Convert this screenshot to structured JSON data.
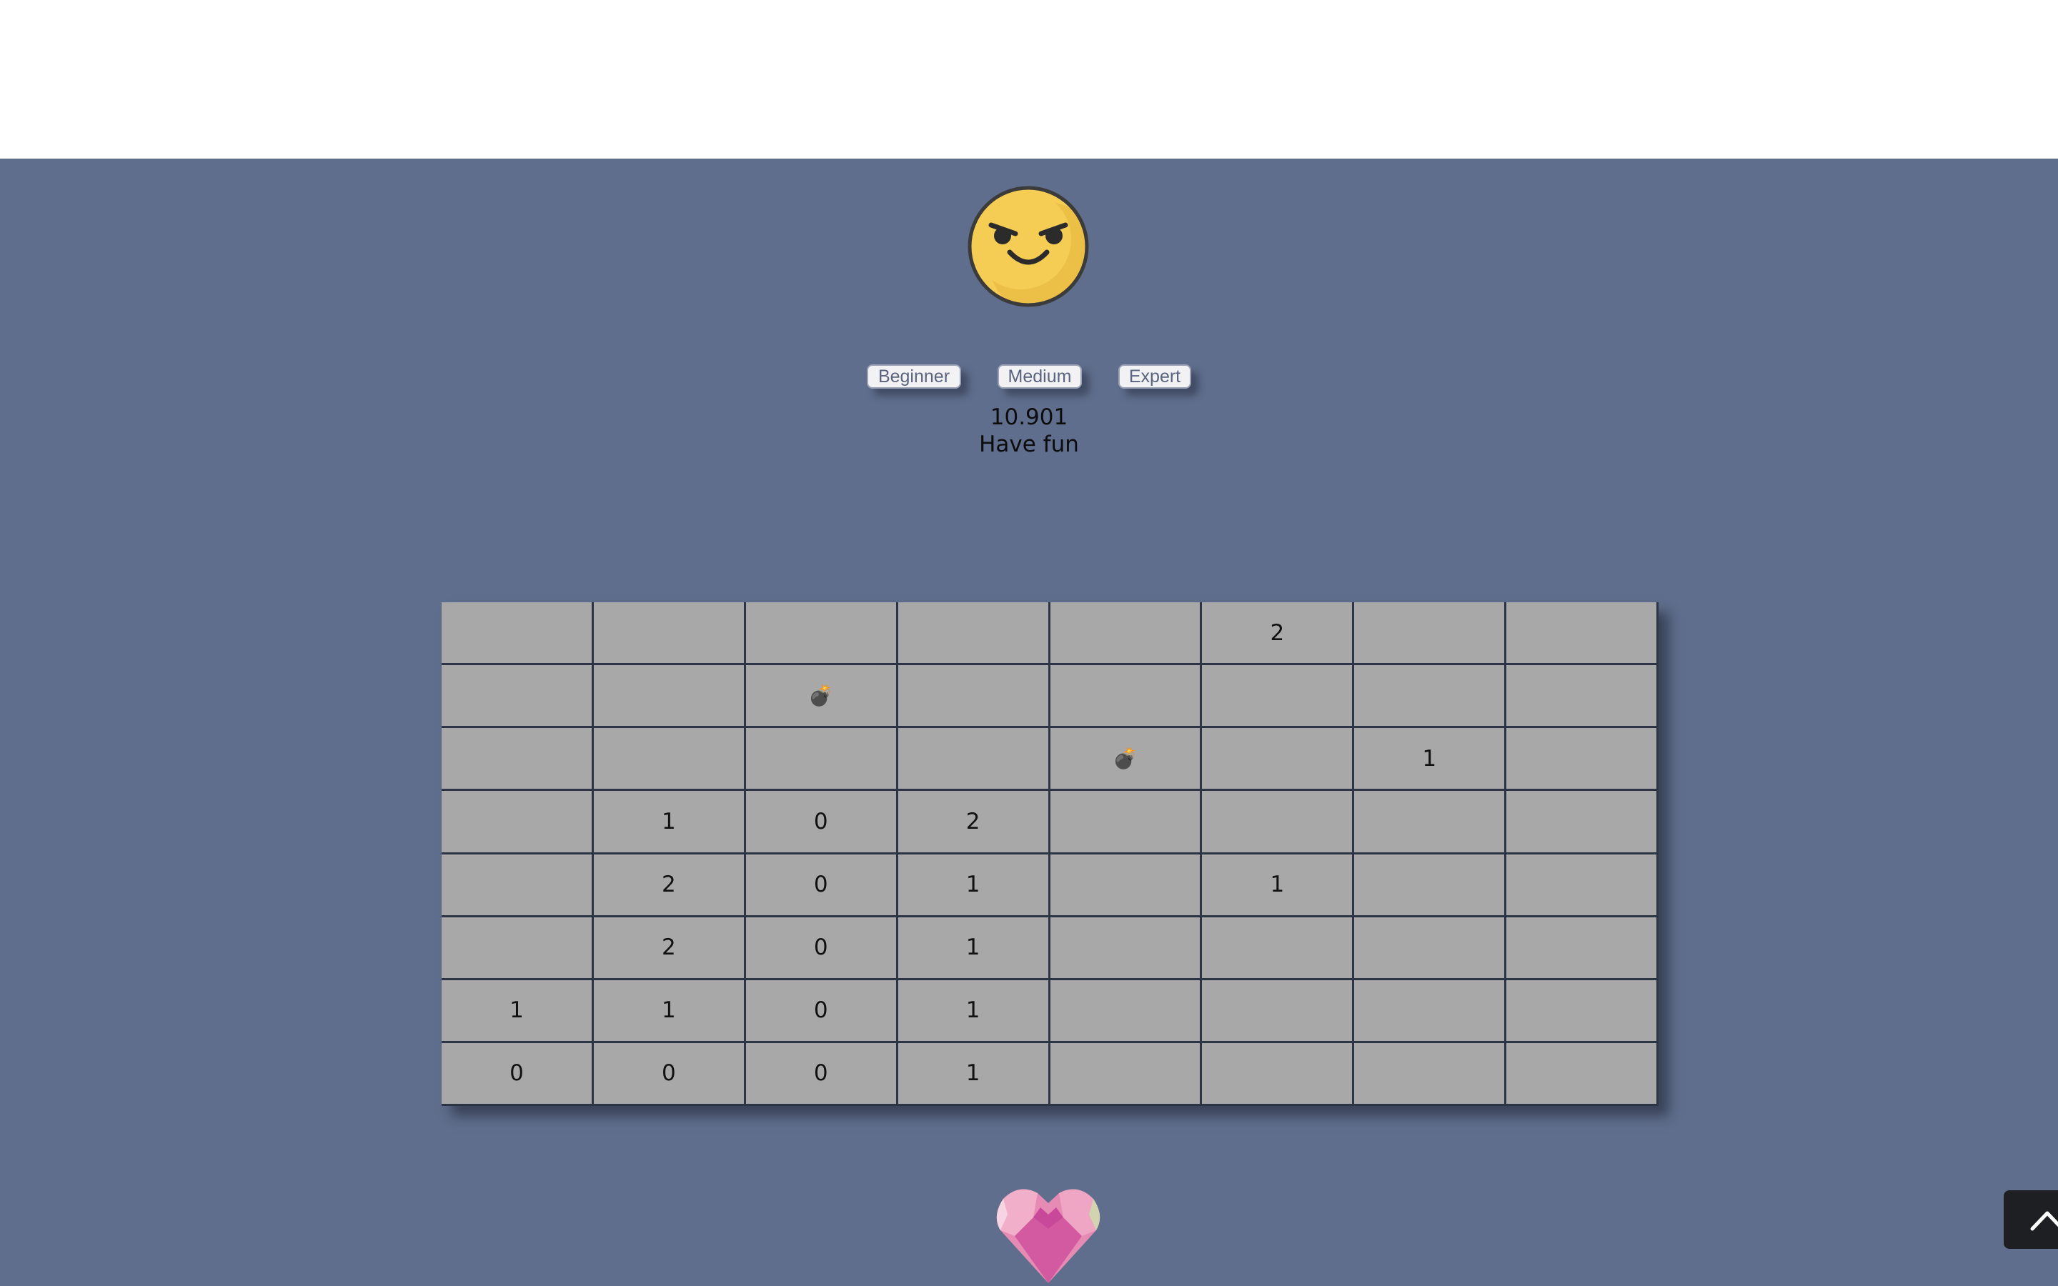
{
  "face": {
    "icon": "angry-smiley-icon",
    "color": "#f5cd55"
  },
  "levels": [
    {
      "label": "Beginner"
    },
    {
      "label": "Medium"
    },
    {
      "label": "Expert"
    }
  ],
  "timer": "10.901",
  "status": "Have fun",
  "board": {
    "rows": 8,
    "cols": 8,
    "cells": [
      [
        "",
        "",
        "",
        "",
        "",
        "2",
        "",
        ""
      ],
      [
        "",
        "",
        "bomb",
        "",
        "",
        "",
        "",
        ""
      ],
      [
        "",
        "",
        "",
        "",
        "bomb",
        "",
        "1",
        ""
      ],
      [
        "",
        "1",
        "0",
        "2",
        "",
        "",
        "",
        ""
      ],
      [
        "",
        "2",
        "0",
        "1",
        "",
        "1",
        "",
        ""
      ],
      [
        "",
        "2",
        "0",
        "1",
        "",
        "",
        "",
        ""
      ],
      [
        "1",
        "1",
        "0",
        "1",
        "",
        "",
        "",
        ""
      ],
      [
        "0",
        "0",
        "0",
        "1",
        "",
        "",
        "",
        ""
      ]
    ],
    "bomb_icon": "💣"
  },
  "footer": {
    "icon": "heart-icon"
  },
  "scroll_top": {
    "icon": "chevron-up-icon"
  },
  "colors": {
    "background": "#5f6e8c",
    "cell": "#a8a8a8",
    "grid_line": "#2d3446"
  }
}
